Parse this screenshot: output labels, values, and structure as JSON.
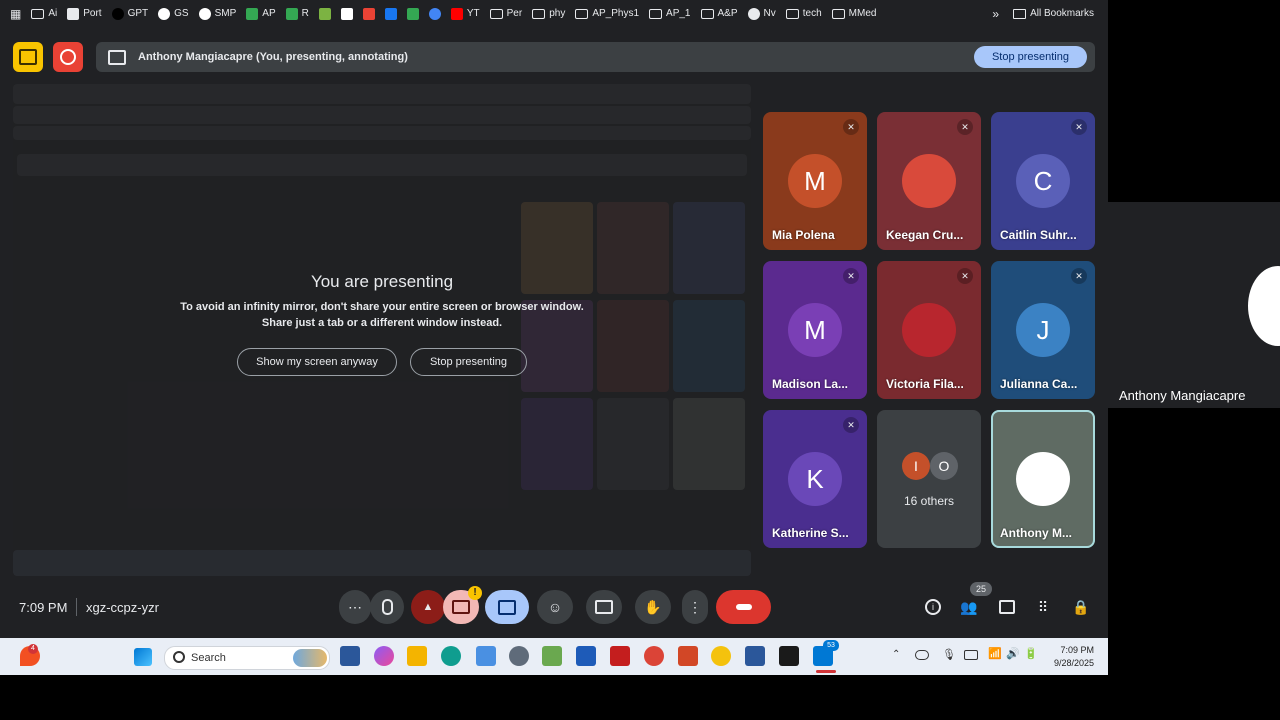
{
  "bookmarks": {
    "items": [
      {
        "label": "Ai",
        "icon": "folder-icon",
        "color": "#e8eaed"
      },
      {
        "label": "Port",
        "icon": "page-icon",
        "color": "#e8eaed"
      },
      {
        "label": "GPT",
        "icon": "openai-icon",
        "color": "#000000"
      },
      {
        "label": "GS",
        "icon": "google-scholar-icon",
        "color": "#ffffff"
      },
      {
        "label": "SMP",
        "icon": "globe-icon",
        "color": "#ffffff"
      },
      {
        "label": "AP",
        "icon": "drive-icon",
        "color": "#34a853"
      },
      {
        "label": "R",
        "icon": "drive-icon",
        "color": "#34a853"
      },
      {
        "label": "",
        "icon": "image-icon",
        "color": "#7cb342"
      },
      {
        "label": "",
        "icon": "amazon-icon",
        "color": "#ffffff"
      },
      {
        "label": "",
        "icon": "gmail-icon",
        "color": "#ea4335"
      },
      {
        "label": "",
        "icon": "facebook-icon",
        "color": "#1877f2"
      },
      {
        "label": "",
        "icon": "drive-icon",
        "color": "#34a853"
      },
      {
        "label": "",
        "icon": "circle-icon",
        "color": "#4285f4"
      },
      {
        "label": "YT",
        "icon": "youtube-icon",
        "color": "#ff0000"
      },
      {
        "label": "Per",
        "icon": "folder-icon",
        "color": "#e8eaed"
      },
      {
        "label": "phy",
        "icon": "folder-icon",
        "color": "#e8eaed"
      },
      {
        "label": "AP_Phys1",
        "icon": "folder-icon",
        "color": "#e8eaed"
      },
      {
        "label": "AP_1",
        "icon": "folder-icon",
        "color": "#e8eaed"
      },
      {
        "label": "A&P",
        "icon": "folder-icon",
        "color": "#e8eaed"
      },
      {
        "label": "Nv",
        "icon": "globe-icon",
        "color": "#e8eaed"
      },
      {
        "label": "tech",
        "icon": "folder-icon",
        "color": "#e8eaed"
      },
      {
        "label": "MMed",
        "icon": "folder-icon",
        "color": "#e8eaed"
      }
    ],
    "more": "»",
    "all_bookmarks": "All Bookmarks"
  },
  "presenting_bar": {
    "text": "Anthony Mangiacapre (You, presenting, annotating)",
    "stop_label": "Stop presenting"
  },
  "preview": {
    "title": "You are presenting",
    "msg_line1": "To avoid an infinity mirror, don't share your entire screen or browser window.",
    "msg_line2": "Share just a tab or a different window instead.",
    "show_anyway": "Show my screen anyway",
    "stop": "Stop presenting"
  },
  "tiles": [
    {
      "name": "Mia Polena",
      "initial": "M",
      "bg": "#8a3a1c",
      "av": "#c4502a",
      "muted": true
    },
    {
      "name": "Keegan Cru...",
      "initial": "",
      "bg": "#7a2f35",
      "av": "#d94a3b",
      "muted": true
    },
    {
      "name": "Caitlin Suhr...",
      "initial": "C",
      "bg": "#3a3f8f",
      "av": "#5a60b8",
      "muted": true
    },
    {
      "name": "Madison La...",
      "initial": "M",
      "bg": "#5b2a8f",
      "av": "#7a3fb5",
      "muted": true
    },
    {
      "name": "Victoria Fila...",
      "initial": "",
      "bg": "#7a2a2f",
      "av": "#b8262e",
      "muted": true
    },
    {
      "name": "Julianna Ca...",
      "initial": "J",
      "bg": "#1f4d7a",
      "av": "#3b82c4",
      "muted": true
    },
    {
      "name": "Katherine S...",
      "initial": "K",
      "bg": "#4a2e8f",
      "av": "#6a48b8",
      "muted": true
    },
    {
      "name": "",
      "others": "16 others",
      "a": "I",
      "b": "O",
      "bg": "#3c4043",
      "muted": false
    },
    {
      "name": "Anthony M...",
      "initial": "",
      "bg": "#5f6b63",
      "av": "#ffffff",
      "muted": false
    }
  ],
  "meeting": {
    "time": "7:09 PM",
    "code": "xgz-ccpz-yzr",
    "people_count": "25",
    "alert": "!"
  },
  "taskbar": {
    "search": "Search",
    "time": "7:09 PM",
    "date": "9/28/2025",
    "badge_count": "53",
    "notif": "4"
  },
  "side": {
    "name": "Anthony Mangiacapre"
  }
}
